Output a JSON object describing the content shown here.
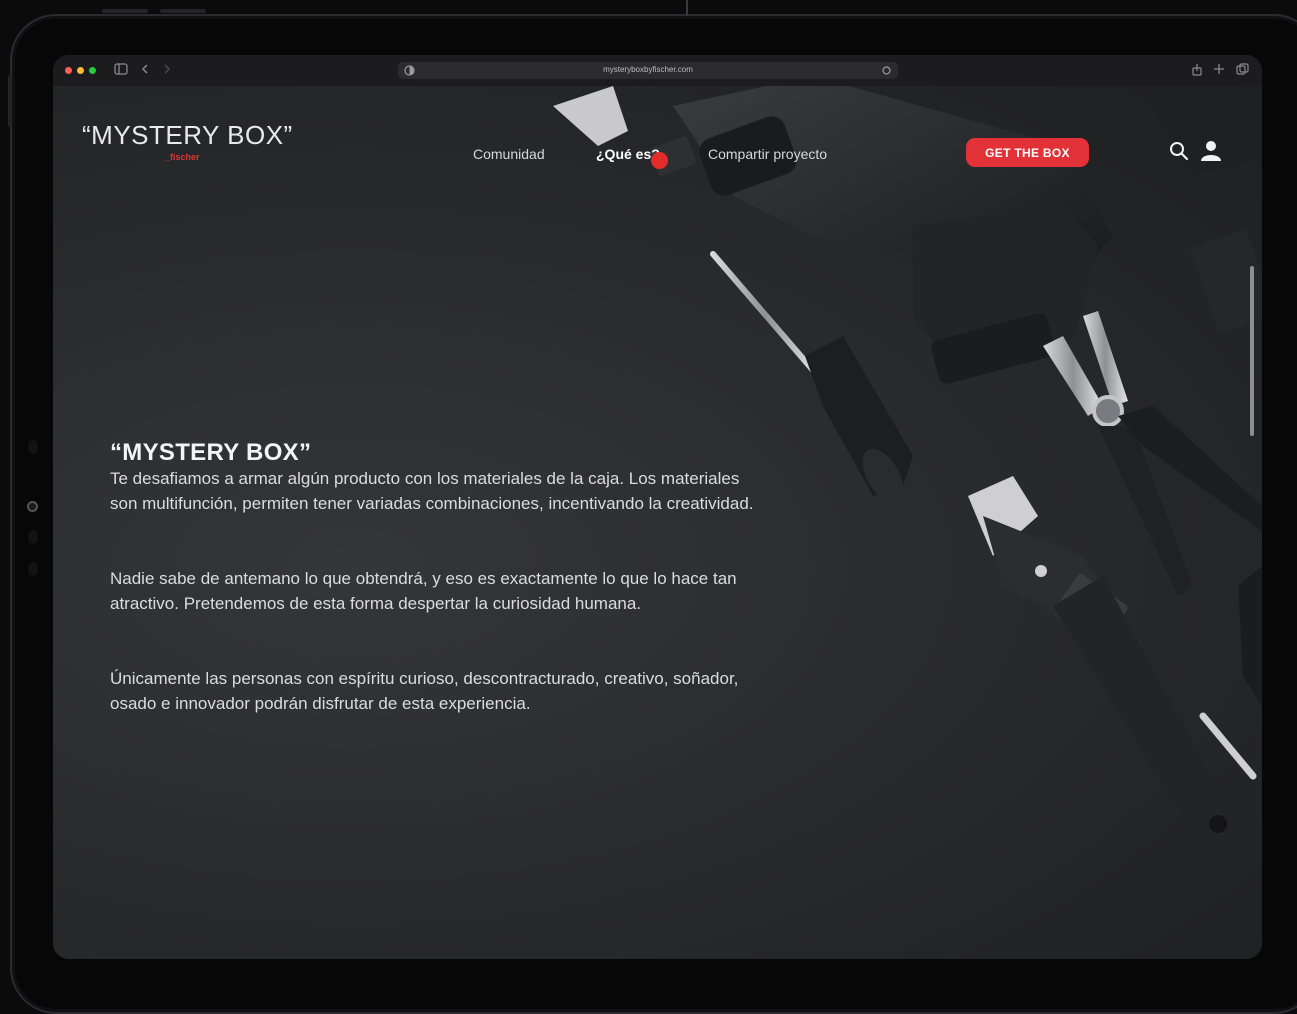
{
  "browser": {
    "url": "mysteryboxbyfischer.com"
  },
  "site": {
    "logo_title": "“MYSTERY BOX”",
    "logo_subtitle": "_fischer"
  },
  "nav": {
    "items": [
      {
        "label": "Comunidad",
        "active": false
      },
      {
        "label": "¿Qué es?",
        "active": true
      },
      {
        "label": "Compartir proyecto",
        "active": false
      }
    ],
    "cta_label": "GET THE BOX"
  },
  "hero": {
    "headline": "“MYSTERY BOX”",
    "paragraphs": [
      "Te desafiamos a armar algún producto con los materiales de la caja. Los materiales son multifunción, permiten tener variadas combinaciones, incentivando la creatividad.",
      "Nadie sabe de antemano lo que obtendrá, y eso es exactamente lo que lo hace tan atractivo. Pretendemos de esta forma despertar la curiosidad humana.",
      "Únicamente las personas con espíritu curioso, descontracturado, creativo, soñador, osado e innovador podrán disfrutar de esta experiencia."
    ]
  },
  "icons": {
    "search": "search-icon",
    "user": "user-icon"
  },
  "colors": {
    "accent": "#e23238",
    "background": "#2a2b2e",
    "text": "#dcdcdd"
  }
}
